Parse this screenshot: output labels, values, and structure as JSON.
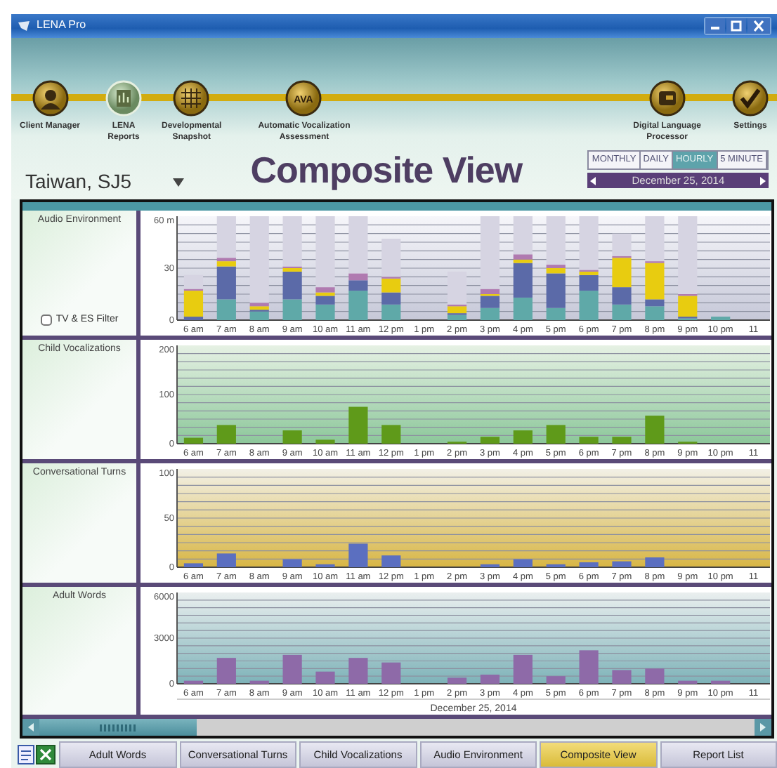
{
  "window": {
    "title": "LENA Pro"
  },
  "toolbar": {
    "left_items": [
      {
        "label": "Client Manager",
        "kind": "person",
        "selected": false
      },
      {
        "label": "LENA\nReports",
        "kind": "report",
        "selected": true
      },
      {
        "label": "Developmental\nSnapshot",
        "kind": "grid",
        "selected": false
      },
      {
        "label": "Automatic Vocalization\nAssessment",
        "kind": "text",
        "icon_text": "AVA",
        "selected": false
      }
    ],
    "right_items": [
      {
        "label": "Digital Language\nProcessor",
        "kind": "device",
        "selected": false
      },
      {
        "label": "Settings",
        "kind": "check",
        "selected": false
      }
    ]
  },
  "client": {
    "name": "Taiwan, SJ5"
  },
  "title": "Composite View",
  "period_tabs": [
    {
      "label": "MONTHLY",
      "selected": false
    },
    {
      "label": "DAILY",
      "selected": false
    },
    {
      "label": "HOURLY",
      "selected": true
    },
    {
      "label": "5 MINUTE",
      "selected": false
    }
  ],
  "date_nav": {
    "date": "December 25, 2014"
  },
  "panels": [
    {
      "title": "Audio Environment",
      "filter": {
        "label": "TV & ES Filter",
        "checked": false
      },
      "chart_data": {
        "type": "bar",
        "stacked": true,
        "categories": [
          "6 am",
          "7 am",
          "8 am",
          "9 am",
          "10 am",
          "11 am",
          "12 pm",
          "1 pm",
          "2 pm",
          "3 pm",
          "4 pm",
          "5 pm",
          "6 pm",
          "7 pm",
          "8 pm",
          "9 pm",
          "10 pm",
          "11"
        ],
        "ylim": [
          0,
          60
        ],
        "yticks": [
          0,
          30,
          {
            "value": 60,
            "label": "60 m"
          }
        ],
        "series": [
          {
            "color": "#5fa9a8",
            "values": [
              0,
              12,
              5,
              12,
              9,
              17,
              9,
              0,
              3,
              7,
              13,
              7,
              17,
              9,
              8,
              1,
              2,
              null
            ]
          },
          {
            "color": "#5b6aa8",
            "values": [
              2,
              19,
              1,
              16,
              5,
              6,
              7,
              0,
              1,
              7,
              20,
              20,
              9,
              10,
              4,
              1,
              0,
              null
            ]
          },
          {
            "color": "#e8cc10",
            "values": [
              15,
              3,
              2,
              2,
              2,
              0,
              8,
              0,
              4,
              1,
              2,
              3,
              2,
              17,
              21,
              12,
              0,
              null
            ]
          },
          {
            "color": "#b07ab0",
            "values": [
              1,
              2,
              2,
              1,
              3,
              4,
              1,
              0,
              1,
              3,
              3,
              2,
              1,
              1,
              1,
              1,
              0,
              null
            ]
          },
          {
            "color": "#d6d4e2",
            "values": [
              8,
              24,
              50,
              29,
              41,
              33,
              22,
              0,
              19,
              42,
              22,
              28,
              31,
              13,
              26,
              45,
              null,
              null
            ]
          }
        ]
      }
    },
    {
      "title": "Child Vocalizations",
      "chart_data": {
        "type": "bar",
        "categories": [
          "6 am",
          "7 am",
          "8 am",
          "9 am",
          "10 am",
          "11 am",
          "12 pm",
          "1 pm",
          "2 pm",
          "3 pm",
          "4 pm",
          "5 pm",
          "6 pm",
          "7 pm",
          "8 pm",
          "9 pm",
          "10 pm",
          "11"
        ],
        "ylim": [
          0,
          200
        ],
        "yticks": [
          0,
          100,
          200
        ],
        "series": [
          {
            "color": "#5f9a1a",
            "values": [
              12,
              38,
              0,
              27,
              8,
              75,
              38,
              0,
              4,
              14,
              27,
              38,
              14,
              14,
              57,
              4,
              0,
              null
            ]
          }
        ]
      }
    },
    {
      "title": "Conversational Turns",
      "chart_data": {
        "type": "bar",
        "categories": [
          "6 am",
          "7 am",
          "8 am",
          "9 am",
          "10 am",
          "11 am",
          "12 pm",
          "1 pm",
          "2 pm",
          "3 pm",
          "4 pm",
          "5 pm",
          "6 pm",
          "7 pm",
          "8 pm",
          "9 pm",
          "10 pm",
          "11"
        ],
        "ylim": [
          0,
          100
        ],
        "yticks": [
          0,
          50,
          100
        ],
        "series": [
          {
            "color": "#5b6fc0",
            "values": [
              4,
              14,
              0,
              8,
              3,
              24,
              12,
              0,
              0,
              3,
              8,
              3,
              5,
              6,
              10,
              0,
              0,
              null
            ]
          }
        ]
      }
    },
    {
      "title": "Adult Words",
      "chart_data": {
        "type": "bar",
        "categories": [
          "6 am",
          "7 am",
          "8 am",
          "9 am",
          "10 am",
          "11 am",
          "12 pm",
          "1 pm",
          "2 pm",
          "3 pm",
          "4 pm",
          "5 pm",
          "6 pm",
          "7 pm",
          "8 pm",
          "9 pm",
          "10 pm",
          "11"
        ],
        "xlabel": "December 25, 2014",
        "ylim": [
          0,
          6000
        ],
        "yticks": [
          0,
          3000,
          6000
        ],
        "series": [
          {
            "color": "#8e6aa8",
            "values": [
              200,
              1700,
              200,
              1900,
              800,
              1700,
              1400,
              0,
              400,
              600,
              1900,
              500,
              2200,
              900,
              1000,
              200,
              200,
              null
            ]
          }
        ]
      }
    }
  ],
  "bottom_tabs": [
    {
      "label": "Adult Words",
      "selected": false
    },
    {
      "label": "Conversational Turns",
      "selected": false
    },
    {
      "label": "Child Vocalizations",
      "selected": false
    },
    {
      "label": "Audio Environment",
      "selected": false
    },
    {
      "label": "Composite View",
      "selected": true
    },
    {
      "label": "Report List",
      "selected": false
    }
  ]
}
